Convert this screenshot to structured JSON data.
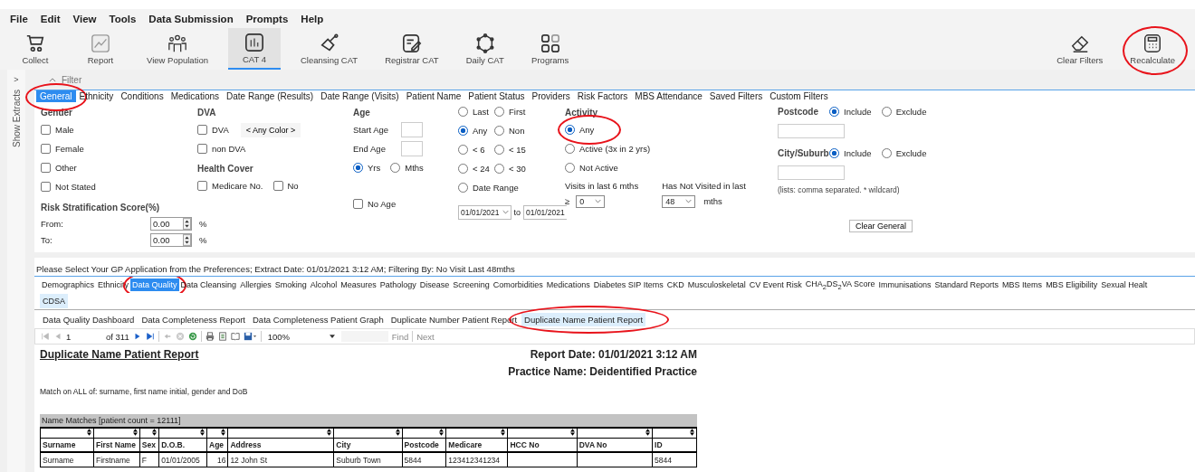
{
  "menu": [
    "File",
    "Edit",
    "View",
    "Tools",
    "Data Submission",
    "Prompts",
    "Help"
  ],
  "toolbar": [
    {
      "label": "Collect",
      "kind": "cart",
      "selected": false
    },
    {
      "label": "Report",
      "kind": "chart",
      "selected": false
    },
    {
      "label": "View Population",
      "kind": "people",
      "selected": false
    },
    {
      "label": "CAT 4",
      "kind": "bars",
      "selected": true
    },
    {
      "label": "Cleansing CAT",
      "kind": "scoop",
      "selected": false
    },
    {
      "label": "Registrar CAT",
      "kind": "note",
      "selected": false
    },
    {
      "label": "Daily CAT",
      "kind": "ring",
      "selected": false
    },
    {
      "label": "Programs",
      "kind": "grid",
      "selected": false
    }
  ],
  "toolbar_right": [
    {
      "label": "Clear Filters",
      "kind": "eraser",
      "highlighted": false
    },
    {
      "label": "Recalculate",
      "kind": "calculator",
      "highlighted": true
    }
  ],
  "side_panel": {
    "arrow": ">",
    "label": "Show Extracts"
  },
  "filter": {
    "title": "Filter"
  },
  "filter_tabs": [
    {
      "label": "General",
      "selected": true,
      "highlighted": true
    },
    {
      "label": "Ethnicity",
      "selected": false,
      "highlighted": false
    },
    {
      "label": "Conditions",
      "selected": false,
      "highlighted": false
    },
    {
      "label": "Medications",
      "selected": false,
      "highlighted": false
    },
    {
      "label": "Date Range (Results)",
      "selected": false,
      "highlighted": false
    },
    {
      "label": "Date Range (Visits)",
      "selected": false,
      "highlighted": false
    },
    {
      "label": "Patient Name",
      "selected": false,
      "highlighted": false
    },
    {
      "label": "Patient Status",
      "selected": false,
      "highlighted": false
    },
    {
      "label": "Providers",
      "selected": false,
      "highlighted": false
    },
    {
      "label": "Risk Factors",
      "selected": false,
      "highlighted": false
    },
    {
      "label": "MBS Attendance",
      "selected": false,
      "highlighted": false
    },
    {
      "label": "Saved Filters",
      "selected": false,
      "highlighted": false
    },
    {
      "label": "Custom Filters",
      "selected": false,
      "highlighted": false
    }
  ],
  "general": {
    "gender": {
      "title": "Gender",
      "options": [
        {
          "label": "Male",
          "checked": false
        },
        {
          "label": "Female",
          "checked": false
        },
        {
          "label": "Other",
          "checked": false
        },
        {
          "label": "Not Stated",
          "checked": false
        }
      ]
    },
    "dva": {
      "title": "DVA",
      "options": [
        {
          "label": "DVA",
          "checked": false
        },
        {
          "label": "non DVA",
          "checked": false
        }
      ],
      "color_button": "< Any Color >"
    },
    "health_cover": {
      "title": "Health Cover",
      "options": [
        {
          "label": "Medicare No.",
          "checked": false
        },
        {
          "label": "No",
          "checked": false
        }
      ]
    },
    "risk": {
      "title": "Risk Stratification Score(%)",
      "fields": [
        {
          "label": "From:",
          "value": "0.00",
          "unit": "%"
        },
        {
          "label": "To:",
          "value": "0.00",
          "unit": "%"
        }
      ]
    },
    "age": {
      "title": "Age",
      "start_label": "Start Age",
      "end_label": "End Age",
      "units": [
        {
          "label": "Yrs",
          "selected": true
        },
        {
          "label": "Mths",
          "selected": false
        }
      ],
      "no_age": {
        "label": "No Age",
        "checked": false
      }
    },
    "age_ranges": [
      {
        "label": "Last",
        "selected": false
      },
      {
        "label": "First",
        "selected": false
      },
      {
        "label": "Any",
        "selected": true
      },
      {
        "label": "Non",
        "selected": false
      },
      {
        "label": "< 6",
        "selected": false
      },
      {
        "label": "< 15",
        "selected": false
      },
      {
        "label": "< 24",
        "selected": false
      },
      {
        "label": "< 30",
        "selected": false
      },
      {
        "label": "Date Range",
        "selected": false
      }
    ],
    "date_from": "01/01/2021",
    "date_to_label": "to",
    "date_to": "01/01/2021",
    "activity": {
      "title": "Activity",
      "options": [
        {
          "label": "Any",
          "selected": true,
          "highlighted": true
        },
        {
          "label": "Active (3x in 2 yrs)",
          "selected": false,
          "highlighted": false
        },
        {
          "label": "Not Active",
          "selected": false,
          "highlighted": false
        }
      ],
      "visits_label": "Visits in last 6 mths",
      "visits_prefix": "≥",
      "visits_value": "0",
      "not_visited_label": "Has Not Visited in last",
      "not_visited_value": "48",
      "not_visited_unit": "mths"
    },
    "places": [
      {
        "label": "Postcode",
        "options": [
          {
            "label": "Include",
            "selected": true
          },
          {
            "label": "Exclude",
            "selected": false
          }
        ]
      },
      {
        "label": "City/Suburb",
        "options": [
          {
            "label": "Include",
            "selected": true
          },
          {
            "label": "Exclude",
            "selected": false
          }
        ]
      }
    ],
    "hint": "(lists: comma separated. * wildcard)",
    "clear_button": "Clear General"
  },
  "status_line": "Please Select Your GP Application from the Preferences; Extract Date: 01/01/2021 3:12 AM; Filtering By: No Visit Last 48mths",
  "report_tabs": [
    [
      {
        "label": "Demographics",
        "selected": false,
        "highlighted": false
      },
      {
        "label": "Ethnicity",
        "selected": false,
        "highlighted": false
      },
      {
        "label": "Data Quality",
        "selected": true,
        "highlighted": true
      },
      {
        "label": "Data Cleansing",
        "selected": false,
        "highlighted": false
      },
      {
        "label": "Allergies",
        "selected": false,
        "highlighted": false
      },
      {
        "label": "Smoking",
        "selected": false,
        "highlighted": false
      },
      {
        "label": "Alcohol",
        "selected": false,
        "highlighted": false
      },
      {
        "label": "Measures",
        "selected": false,
        "highlighted": false
      },
      {
        "label": "Pathology",
        "selected": false,
        "highlighted": false
      },
      {
        "label": "Disease",
        "selected": false,
        "highlighted": false
      },
      {
        "label": "Screening",
        "selected": false,
        "highlighted": false
      },
      {
        "label": "Comorbidities",
        "selected": false,
        "highlighted": false
      },
      {
        "label": "Medications",
        "selected": false,
        "highlighted": false
      },
      {
        "label": "Diabetes SIP Items",
        "selected": false,
        "highlighted": false
      },
      {
        "label": "CKD",
        "selected": false,
        "highlighted": false
      },
      {
        "label": "Musculoskeletal",
        "selected": false,
        "highlighted": false
      },
      {
        "label": "CV Event Risk",
        "selected": false,
        "highlighted": false
      },
      {
        "label": "CHA$_{2}$DS$_{2}$VA Score",
        "selected": false,
        "highlighted": false
      },
      {
        "label": "Immunisations",
        "selected": false,
        "highlighted": false
      },
      {
        "label": "Standard Reports",
        "selected": false,
        "highlighted": false
      },
      {
        "label": "MBS Items",
        "selected": false,
        "highlighted": false
      },
      {
        "label": "MBS Eligibility",
        "selected": false,
        "highlighted": false
      },
      {
        "label": "Sexual Healt",
        "selected": false,
        "highlighted": false
      }
    ],
    [
      {
        "label": "CDSA",
        "selected": false,
        "highlighted": false
      }
    ]
  ],
  "sub_tabs": [
    {
      "label": "Data Quality Dashboard",
      "selected": false,
      "highlighted": false
    },
    {
      "label": "Data Completeness Report",
      "selected": false,
      "highlighted": false
    },
    {
      "label": "Data Completeness Patient Graph",
      "selected": false,
      "highlighted": false
    },
    {
      "label": "Duplicate Number Patient Report",
      "selected": false,
      "highlighted": false
    },
    {
      "label": "Duplicate Name Patient Report",
      "selected": true,
      "highlighted": true
    }
  ],
  "viewer": {
    "page": "1",
    "page_count": "of 311",
    "zoom": "100%",
    "find": "Find",
    "next": "Next"
  },
  "report": {
    "title": "Duplicate Name Patient Report",
    "report_date": "Report Date: 01/01/2021 3:12 AM",
    "practice": "Practice Name: Deidentified Practice",
    "match_text": "Match on ALL of: surname, first name initial, gender and DoB",
    "group": "Name Matches [patient count = 12111]",
    "columns": [
      {
        "label": "Surname"
      },
      {
        "label": "First Name"
      },
      {
        "label": "Sex"
      },
      {
        "label": "D.O.B."
      },
      {
        "label": "Age"
      },
      {
        "label": "Address"
      },
      {
        "label": "City"
      },
      {
        "label": "Postcode"
      },
      {
        "label": "Medicare"
      },
      {
        "label": "HCC No"
      },
      {
        "label": "DVA No"
      },
      {
        "label": "ID"
      }
    ],
    "rows": [
      [
        "Surname",
        "Firstname",
        "F",
        "01/01/2005",
        "16",
        "12 John St",
        "Suburb Town",
        "5844",
        "123412341234",
        null,
        null,
        "5844"
      ]
    ]
  }
}
